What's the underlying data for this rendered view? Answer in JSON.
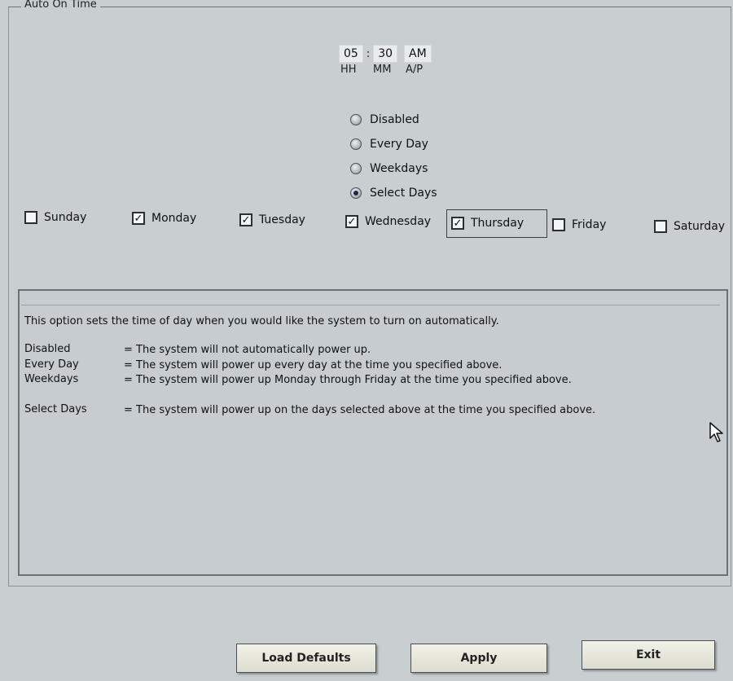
{
  "group": {
    "title": "Auto On Time"
  },
  "time": {
    "hh": "05",
    "mm": "30",
    "ap": "AM",
    "separator": ":",
    "hh_label": "HH",
    "mm_label": "MM",
    "ap_label": "A/P"
  },
  "options": [
    {
      "label": "Disabled",
      "selected": false
    },
    {
      "label": "Every Day",
      "selected": false
    },
    {
      "label": "Weekdays",
      "selected": false
    },
    {
      "label": "Select Days",
      "selected": true
    }
  ],
  "days": [
    {
      "label": "Sunday",
      "checked": false
    },
    {
      "label": "Monday",
      "checked": true
    },
    {
      "label": "Tuesday",
      "checked": true
    },
    {
      "label": "Wednesday",
      "checked": true
    },
    {
      "label": "Thursday",
      "checked": true
    },
    {
      "label": "Friday",
      "checked": false
    },
    {
      "label": "Saturday",
      "checked": false
    }
  ],
  "help": {
    "intro": "This option sets the time of day when you would like the system to turn on automatically.",
    "rows": [
      {
        "term": "Disabled",
        "desc": "= The system will not automatically power up."
      },
      {
        "term": "Every Day",
        "desc": "= The system will power up every day at the time you specified above."
      },
      {
        "term": "Weekdays",
        "desc": "= The system will power up Monday through Friday at the time you specified above."
      },
      {
        "term": "Select Days",
        "desc": "= The system will power up on the days selected above at the time you specified above."
      }
    ]
  },
  "buttons": {
    "load_defaults": "Load Defaults",
    "apply": "Apply",
    "exit": "Exit"
  }
}
